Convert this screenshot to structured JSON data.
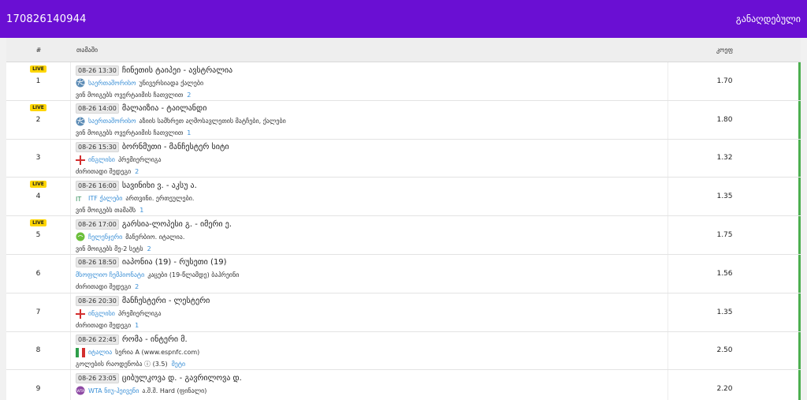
{
  "header": {
    "code": "170826140944",
    "status": "განაღდებული"
  },
  "table": {
    "headers": {
      "num": "#",
      "game": "თამაში",
      "odds": "კოეფ"
    },
    "live_label": "LIVE",
    "rows": [
      {
        "num": "1",
        "live": true,
        "time": "08-26 13:30",
        "teams": "ჩინეთის ტაიპეი - ავსტრალია",
        "icon": "volleyball-icon",
        "sport": "საერთაშორისო",
        "league": "უნივერსიადა ქალები",
        "market": "ვინ მოიგებს ოვერტაიმის ჩათვლით",
        "count": "2",
        "odds": "1.70"
      },
      {
        "num": "2",
        "live": true,
        "time": "08-26 14:00",
        "teams": "მალაიზია - ტაილანდი",
        "icon": "volleyball-icon",
        "sport": "საერთაშორისო",
        "league": "აზიის სამხრეთ აღმოსავლეთის მატჩები, ქალები",
        "market": "ვინ მოიგებს ოვერტაიმის ჩათვლით",
        "count": "1",
        "odds": "1.80"
      },
      {
        "num": "3",
        "live": false,
        "time": "08-26 15:30",
        "teams": "ბორნმუთი - მანჩესტერ სიტი",
        "icon": "england-flag-icon",
        "sport": "ინგლისი",
        "league": "პრემიერლიგა",
        "market": "ძირითადი შედეგი",
        "count": "2",
        "odds": "1.32"
      },
      {
        "num": "4",
        "live": true,
        "time": "08-26 16:00",
        "teams": "სავინიხი ვ. - აკსუ ა.",
        "icon": "itf-icon",
        "sport": "ITF ქალები",
        "league": "ართვინი. ერთეულები.",
        "market": "ვინ მოიგებს თამაშს",
        "count": "1",
        "odds": "1.35"
      },
      {
        "num": "5",
        "live": true,
        "time": "08-26 17:00",
        "teams": "გარსია-ლოპესი გ. - იმერი ე.",
        "icon": "challenger-icon",
        "sport": "ჩელენჯერი",
        "league": "მანერბიო. იტალია.",
        "market": "ვინ მოიგებს მე-2 სეტს",
        "count": "2",
        "odds": "1.75"
      },
      {
        "num": "6",
        "live": false,
        "time": "08-26 18:50",
        "teams": "იაპონია (19) - რუსეთი (19)",
        "icon": "",
        "sport": "მსოფლიო ჩემპიონატი",
        "league": "კაცები (19-წლამდე) ბაჰრეინი",
        "market": "ძირითადი შედეგი",
        "count": "2",
        "odds": "1.56"
      },
      {
        "num": "7",
        "live": false,
        "time": "08-26 20:30",
        "teams": "მანჩესტერი - ლესტერი",
        "icon": "england-flag-icon",
        "sport": "ინგლისი",
        "league": "პრემიერლიგა",
        "market": "ძირითადი შედეგი",
        "count": "1",
        "odds": "1.35"
      },
      {
        "num": "8",
        "live": false,
        "time": "08-26 22:45",
        "teams": "რომა - ინტერი მ.",
        "icon": "italy-flag-icon",
        "sport": "იტალია",
        "league": "სერია A (www.espnfc.com)",
        "market": "გოლების რაოდენობა ⓘ (3.5)",
        "count": "მეტი",
        "odds": "2.50"
      },
      {
        "num": "9",
        "live": false,
        "time": "08-26 23:05",
        "teams": "ციბულკოვა დ. - გავრილოვა დ.",
        "icon": "wta-icon",
        "sport": "WTA ნიუ-ჰეივენი",
        "league": "ა.შ.შ. Hard (ფინალი)",
        "market": "",
        "count": "",
        "odds": "2.20"
      }
    ]
  },
  "colors": {
    "topbar": "#6a0fd3",
    "live": "#ffd600",
    "link": "#3a8fd6",
    "accent": "#4caf50"
  }
}
